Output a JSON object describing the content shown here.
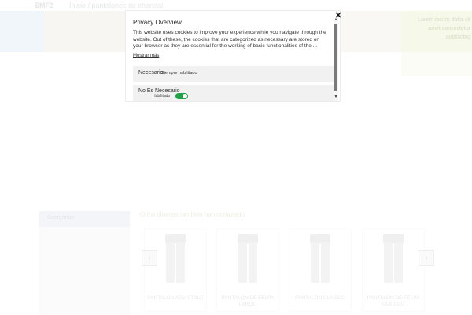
{
  "background": {
    "logo": "SMF2",
    "path": "Inicio / pantalones de chandal",
    "promo_text": "Lorem ipsum dolor sit amet consectetur adipiscing",
    "side_panel_title": "Categorías",
    "section_title": "Otros clientes también han comprado",
    "products": [
      {
        "name": "PANTALÓN ADV STYLE"
      },
      {
        "name": "PANTALÓN DE FELPA LARGO"
      },
      {
        "name": "PANTALÓN CLASSIC"
      },
      {
        "name": "PANTALÓN DE FELPA CLÁSICO"
      }
    ],
    "arrow_left": "‹",
    "arrow_right": "›"
  },
  "modal": {
    "title": "Privacy Overview",
    "body": "This website uses cookies to improve your experience while you navigate through the website. Out of these, the cookies that are categorized as necessary are stored on your browser as they are essential for the working of basic functionalities of the ...",
    "show_more": "Mostrar más",
    "close_symbol": "✕",
    "rows": [
      {
        "title": "Necesario",
        "status": "Siempre habilitado"
      },
      {
        "title": "No Es Necesario",
        "toggle_label": "Habilitado",
        "toggle_on": true
      }
    ],
    "toggle_color": "#24a148"
  }
}
